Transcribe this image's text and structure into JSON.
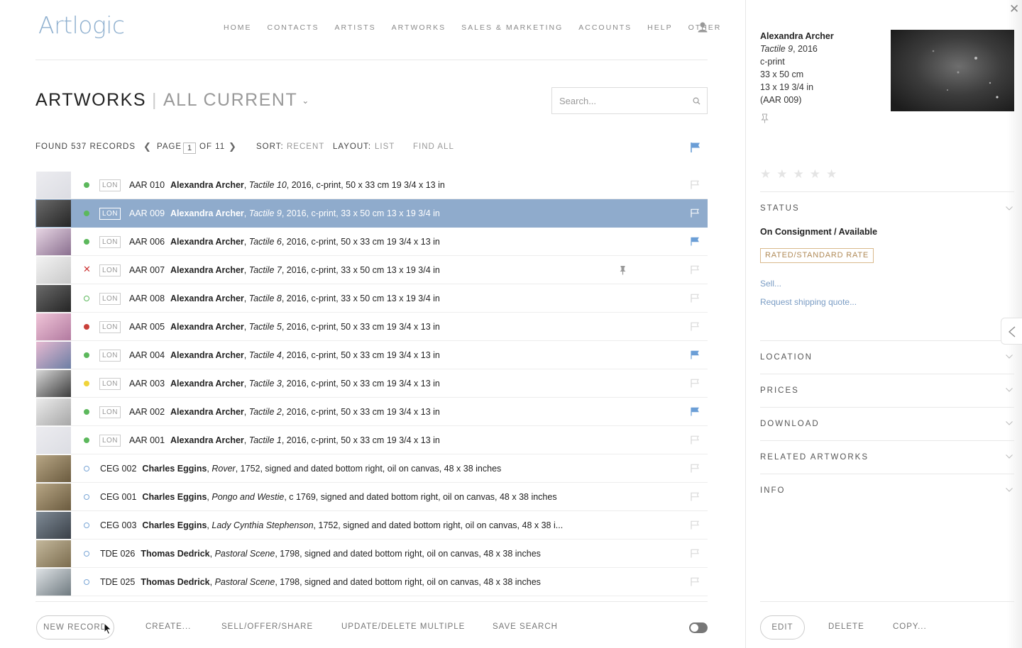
{
  "header": {
    "logo": "Artlogic",
    "nav": [
      "HOME",
      "CONTACTS",
      "ARTISTS",
      "ARTWORKS",
      "SALES & MARKETING",
      "ACCOUNTS",
      "HELP",
      "OTHER"
    ]
  },
  "heading": {
    "title": "ARTWORKS",
    "separator": "|",
    "subtitle": "ALL CURRENT"
  },
  "search": {
    "placeholder": "Search..."
  },
  "toolbar": {
    "found_label": "FOUND",
    "found_count": "537",
    "records_label": "RECORDS",
    "page_label": "PAGE",
    "page_current": "1",
    "page_of": "OF 11",
    "sort_label": "SORT:",
    "sort_value": "RECENT",
    "layout_label": "LAYOUT:",
    "layout_value": "LIST",
    "find_all": "FIND ALL"
  },
  "colors": {
    "accent": "#8fabcc",
    "flag_blue": "#6b9ed6",
    "status_green": "#5cb85c",
    "status_red": "#c9403a",
    "status_yellow": "#f0d43a",
    "status_ring_blue": "#7aa6d6"
  },
  "records": [
    {
      "code": "AAR 010",
      "artist": "Alexandra Archer",
      "title": "Tactile 10",
      "details": ", 2016, c-print, 50 x 33 cm 19 3/4 x 13 in",
      "location": "LON",
      "status": "green",
      "flag": "empty",
      "thumb": "pale"
    },
    {
      "code": "AAR 009",
      "artist": "Alexandra Archer",
      "title": "Tactile 9",
      "details": ", 2016, c-print, 33 x 50 cm 13 x 19 3/4 in",
      "location": "LON",
      "status": "green",
      "flag": "selected",
      "thumb": "dark",
      "selected": true
    },
    {
      "code": "AAR 006",
      "artist": "Alexandra Archer",
      "title": "Tactile 6",
      "details": ", 2016, c-print, 50 x 33 cm 19 3/4 x 13 in",
      "location": "LON",
      "status": "green",
      "flag": "blue",
      "thumb": "marble"
    },
    {
      "code": "AAR 007",
      "artist": "Alexandra Archer",
      "title": "Tactile 7",
      "details": ", 2016, c-print, 33 x 50 cm 13 x 19 3/4 in",
      "location": "LON",
      "status": "cross",
      "flag": "empty",
      "thumb": "white",
      "pin": true
    },
    {
      "code": "AAR 008",
      "artist": "Alexandra Archer",
      "title": "Tactile 8",
      "details": ", 2016, c-print, 33 x 50 cm 13 x 19 3/4 in",
      "location": "LON",
      "status": "ring-green",
      "flag": "empty",
      "thumb": "dark"
    },
    {
      "code": "AAR 005",
      "artist": "Alexandra Archer",
      "title": "Tactile 5",
      "details": ", 2016, c-print, 50 x 33 cm 19 3/4 x 13 in",
      "location": "LON",
      "status": "red",
      "flag": "empty",
      "thumb": "pink"
    },
    {
      "code": "AAR 004",
      "artist": "Alexandra Archer",
      "title": "Tactile 4",
      "details": ", 2016, c-print, 50 x 33 cm 19 3/4 x 13 in",
      "location": "LON",
      "status": "green",
      "flag": "blue",
      "thumb": "pinkblue"
    },
    {
      "code": "AAR 003",
      "artist": "Alexandra Archer",
      "title": "Tactile 3",
      "details": ", 2016, c-print, 50 x 33 cm 19 3/4 x 13 in",
      "location": "LON",
      "status": "yellow",
      "flag": "empty",
      "thumb": "grey"
    },
    {
      "code": "AAR 002",
      "artist": "Alexandra Archer",
      "title": "Tactile 2",
      "details": ", 2016, c-print, 50 x 33 cm 19 3/4 x 13 in",
      "location": "LON",
      "status": "green",
      "flag": "blue",
      "thumb": "lightgrey"
    },
    {
      "code": "AAR 001",
      "artist": "Alexandra Archer",
      "title": "Tactile 1",
      "details": ", 2016, c-print, 50 x 33 cm 19 3/4 x 13 in",
      "location": "LON",
      "status": "green",
      "flag": "empty",
      "thumb": "pale"
    },
    {
      "code": "CEG 002",
      "artist": "Charles Eggins",
      "title": "Rover",
      "details": ", 1752, signed and dated bottom right, oil on canvas, 48 x 38 inches",
      "location": "",
      "status": "ring-blue",
      "flag": "empty",
      "thumb": "painting"
    },
    {
      "code": "CEG 001",
      "artist": "Charles Eggins",
      "title": "Pongo and Westie",
      "details": ", c 1769, signed and dated bottom right, oil on canvas, 48 x 38 inches",
      "location": "",
      "status": "ring-blue",
      "flag": "empty",
      "thumb": "painting"
    },
    {
      "code": "CEG 003",
      "artist": "Charles Eggins",
      "title": "Lady Cynthia Stephenson",
      "details": ", 1752, signed and dated bottom right, oil on canvas, 48 x 38 i...",
      "location": "",
      "status": "ring-blue",
      "flag": "empty",
      "thumb": "portrait"
    },
    {
      "code": "TDE 026",
      "artist": "Thomas Dedrick",
      "title": "Pastoral Scene",
      "details": ", 1798, signed and dated bottom right, oil on canvas, 48 x 38 inches",
      "location": "",
      "status": "ring-blue",
      "flag": "empty",
      "thumb": "landscape"
    },
    {
      "code": "TDE 025",
      "artist": "Thomas Dedrick",
      "title": "Pastoral Scene",
      "details": ", 1798, signed and dated bottom right, oil on canvas, 48 x 38 inches",
      "location": "",
      "status": "ring-blue",
      "flag": "empty",
      "thumb": "winter"
    }
  ],
  "bottom_bar": {
    "new_record": "NEW RECORD",
    "create": "CREATE...",
    "sell_offer_share": "SELL/OFFER/SHARE",
    "update_delete": "UPDATE/DELETE MULTIPLE",
    "save_search": "SAVE SEARCH"
  },
  "panel": {
    "artist": "Alexandra Archer",
    "title": "Tactile 9",
    "year": ", 2016",
    "medium": "c-print",
    "size_cm": "33 x 50 cm",
    "size_in": "13 x 19 3/4 in",
    "code": "(AAR 009)",
    "rating": 0,
    "sections": {
      "status": "STATUS",
      "location": "LOCATION",
      "prices": "PRICES",
      "download": "DOWNLOAD",
      "related": "RELATED ARTWORKS",
      "info": "INFO"
    },
    "status_value": "On Consignment / Available",
    "rate_badge": "RATED/STANDARD RATE",
    "sell_link": "Sell...",
    "shipping_link": "Request shipping quote...",
    "edit": "EDIT",
    "delete": "DELETE",
    "copy": "COPY..."
  }
}
